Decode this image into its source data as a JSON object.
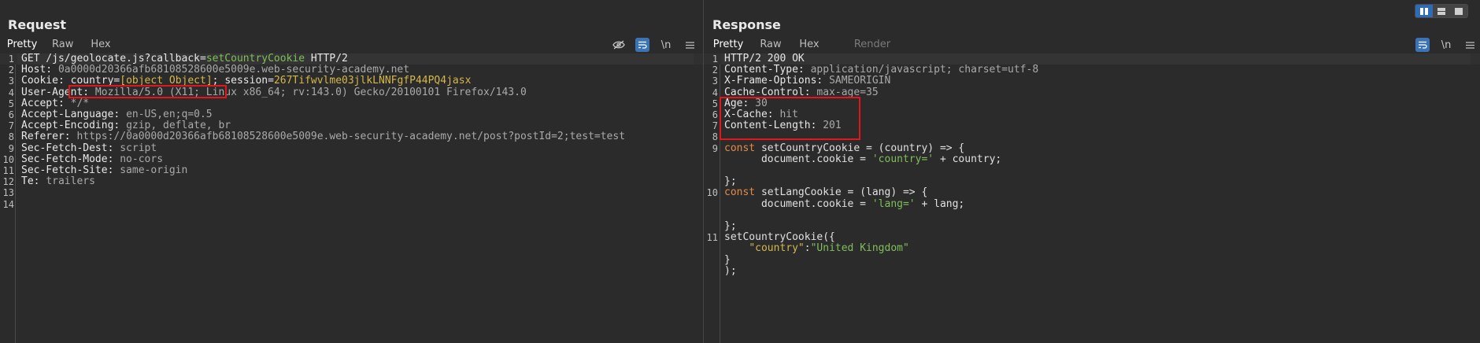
{
  "request": {
    "title": "Request",
    "tabs": [
      "Pretty",
      "Raw",
      "Hex"
    ],
    "active_tab": "Pretty",
    "icons": [
      "eye-off-icon",
      "word-wrap-icon",
      "newline-icon",
      "menu-icon"
    ],
    "newline_label": "\\n",
    "lines": [
      {
        "n": "1",
        "parts": [
          {
            "t": "GET /js/geolocate.js?",
            "c": "k"
          },
          {
            "t": "callback",
            "c": "k"
          },
          {
            "t": "=",
            "c": "k"
          },
          {
            "t": "setCountryCookie",
            "c": "g"
          },
          {
            "t": " HTTP/2",
            "c": "k"
          }
        ]
      },
      {
        "n": "2",
        "parts": [
          {
            "t": "Host: ",
            "c": "k"
          },
          {
            "t": "0a0000d20366afb68108528600e5009e.web-security-academy.net",
            "c": "v"
          }
        ]
      },
      {
        "n": "3",
        "parts": [
          {
            "t": "Cookie: ",
            "c": "k"
          },
          {
            "t": "country",
            "c": "k"
          },
          {
            "t": "=",
            "c": "k"
          },
          {
            "t": "[object Object]",
            "c": "p"
          },
          {
            "t": "; ",
            "c": "k"
          },
          {
            "t": "session",
            "c": "k"
          },
          {
            "t": "=",
            "c": "k"
          },
          {
            "t": "267Tifwvlme03jlkLNNFgfP44PQ4jasx",
            "c": "p"
          }
        ]
      },
      {
        "n": "4",
        "parts": [
          {
            "t": "User-Agent: ",
            "c": "k"
          },
          {
            "t": "Mozilla/5.0 (X11; Linux x86_64; rv:143.0) Gecko/20100101 Firefox/143.0",
            "c": "v"
          }
        ]
      },
      {
        "n": "5",
        "parts": [
          {
            "t": "Accept: ",
            "c": "k"
          },
          {
            "t": "*/*",
            "c": "v"
          }
        ]
      },
      {
        "n": "6",
        "parts": [
          {
            "t": "Accept-Language: ",
            "c": "k"
          },
          {
            "t": "en-US,en;q=0.5",
            "c": "v"
          }
        ]
      },
      {
        "n": "7",
        "parts": [
          {
            "t": "Accept-Encoding: ",
            "c": "k"
          },
          {
            "t": "gzip, deflate, br",
            "c": "v"
          }
        ]
      },
      {
        "n": "8",
        "parts": [
          {
            "t": "Referer: ",
            "c": "k"
          },
          {
            "t": "https://0a0000d20366afb68108528600e5009e.web-security-academy.net/post?postId=2;test=test",
            "c": "v"
          }
        ]
      },
      {
        "n": "9",
        "parts": [
          {
            "t": "Sec-Fetch-Dest: ",
            "c": "k"
          },
          {
            "t": "script",
            "c": "v"
          }
        ]
      },
      {
        "n": "10",
        "parts": [
          {
            "t": "Sec-Fetch-Mode: ",
            "c": "k"
          },
          {
            "t": "no-cors",
            "c": "v"
          }
        ]
      },
      {
        "n": "11",
        "parts": [
          {
            "t": "Sec-Fetch-Site: ",
            "c": "k"
          },
          {
            "t": "same-origin",
            "c": "v"
          }
        ]
      },
      {
        "n": "12",
        "parts": [
          {
            "t": "Te: ",
            "c": "k"
          },
          {
            "t": "trailers",
            "c": "v"
          }
        ]
      },
      {
        "n": "13",
        "parts": []
      },
      {
        "n": "14",
        "parts": []
      }
    ]
  },
  "response": {
    "title": "Response",
    "tabs": [
      "Pretty",
      "Raw",
      "Hex",
      "Render"
    ],
    "active_tab": "Pretty",
    "icons": [
      "word-wrap-icon",
      "newline-icon",
      "menu-icon"
    ],
    "newline_label": "\\n",
    "lines": [
      {
        "n": "1",
        "parts": [
          {
            "t": "HTTP/2 200 OK",
            "c": "k"
          }
        ]
      },
      {
        "n": "2",
        "parts": [
          {
            "t": "Content-Type: ",
            "c": "k"
          },
          {
            "t": "application/javascript; charset=utf-8",
            "c": "v"
          }
        ]
      },
      {
        "n": "3",
        "parts": [
          {
            "t": "X-Frame-Options: ",
            "c": "k"
          },
          {
            "t": "SAMEORIGIN",
            "c": "v"
          }
        ]
      },
      {
        "n": "4",
        "parts": [
          {
            "t": "Cache-Control: ",
            "c": "k"
          },
          {
            "t": "max-age=35",
            "c": "v"
          }
        ]
      },
      {
        "n": "5",
        "parts": [
          {
            "t": "Age: ",
            "c": "k"
          },
          {
            "t": "30",
            "c": "v"
          }
        ]
      },
      {
        "n": "6",
        "parts": [
          {
            "t": "X-Cache: ",
            "c": "k"
          },
          {
            "t": "hit",
            "c": "v"
          }
        ]
      },
      {
        "n": "7",
        "parts": [
          {
            "t": "Content-Length: ",
            "c": "k"
          },
          {
            "t": "201",
            "c": "v"
          }
        ]
      },
      {
        "n": "8",
        "parts": []
      },
      {
        "n": "9",
        "parts": [
          {
            "t": "const",
            "c": "kw"
          },
          {
            "t": " setCountryCookie = (country) => {",
            "c": "plain"
          }
        ]
      },
      {
        "n": "",
        "parts": [
          {
            "t": "      document.cookie = ",
            "c": "plain"
          },
          {
            "t": "'country='",
            "c": "g"
          },
          {
            "t": " + country;",
            "c": "plain"
          }
        ]
      },
      {
        "n": "",
        "parts": []
      },
      {
        "n": "",
        "parts": [
          {
            "t": "};",
            "c": "plain"
          }
        ]
      },
      {
        "n": "10",
        "parts": [
          {
            "t": "const",
            "c": "kw"
          },
          {
            "t": " setLangCookie = (lang) => {",
            "c": "plain"
          }
        ]
      },
      {
        "n": "",
        "parts": [
          {
            "t": "      document.cookie = ",
            "c": "plain"
          },
          {
            "t": "'lang='",
            "c": "g"
          },
          {
            "t": " + lang;",
            "c": "plain"
          }
        ]
      },
      {
        "n": "",
        "parts": []
      },
      {
        "n": "",
        "parts": [
          {
            "t": "};",
            "c": "plain"
          }
        ]
      },
      {
        "n": "11",
        "parts": [
          {
            "t": "setCountryCookie({",
            "c": "plain"
          }
        ]
      },
      {
        "n": "",
        "parts": [
          {
            "t": "    ",
            "c": "plain"
          },
          {
            "t": "\"country\"",
            "c": "p"
          },
          {
            "t": ":",
            "c": "plain"
          },
          {
            "t": "\"United Kingdom\"",
            "c": "g"
          }
        ]
      },
      {
        "n": "",
        "parts": [
          {
            "t": "}",
            "c": "plain"
          }
        ]
      },
      {
        "n": "",
        "parts": [
          {
            "t": ");",
            "c": "plain"
          }
        ]
      }
    ]
  }
}
